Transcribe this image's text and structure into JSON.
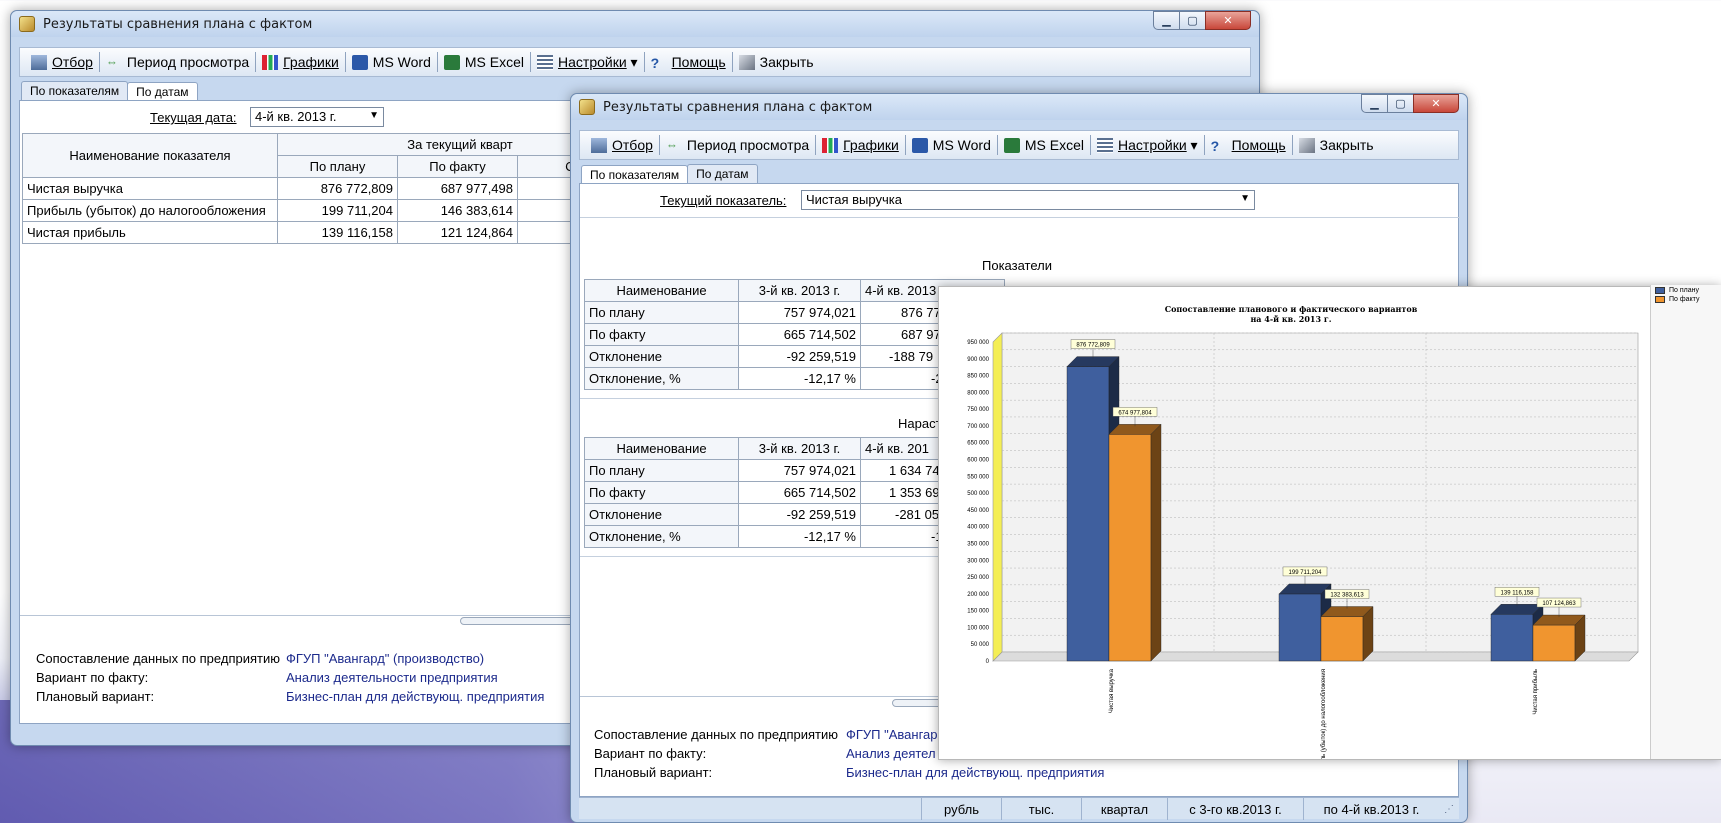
{
  "window_back": {
    "title": "Результаты сравнения плана с фактом",
    "toolbar": [
      "Отбор",
      "Период просмотра",
      "Графики",
      "MS Word",
      "MS Excel",
      "Настройки",
      "Помощь",
      "Закрыть"
    ],
    "tabs": [
      "По показателям",
      "По датам"
    ],
    "current_date_label": "Текущая дата:",
    "current_date_value": "4-й кв. 2013 г.",
    "table": {
      "name_header": "Наименование показателя",
      "group_header": "За текущий кварт",
      "columns": [
        "По плану",
        "По факту",
        "Откл"
      ],
      "rows": [
        {
          "name": "Чистая выручка",
          "plan": "876 772,809",
          "fact": "687 977,498",
          "dev": "-1"
        },
        {
          "name": "Прибыль (убыток) до налогообложения",
          "plan": "199 711,204",
          "fact": "146 383,614",
          "dev": "-"
        },
        {
          "name": "Чистая прибыль",
          "plan": "139 116,158",
          "fact": "121 124,864",
          "dev": "-"
        }
      ]
    },
    "footer": {
      "compare_label": "Сопоставление данных по предприятию",
      "compare_value": "ФГУП \"Авангард\" (производство)",
      "fact_label": "Вариант по факту:",
      "fact_value": "Анализ деятельности предприятия",
      "plan_label": "Плановый вариант:",
      "plan_value": "Бизнес-план для действующ. предприятия"
    }
  },
  "window_front": {
    "title": "Результаты сравнения плана с фактом",
    "toolbar": [
      "Отбор",
      "Период просмотра",
      "Графики",
      "MS Word",
      "MS Excel",
      "Настройки",
      "Помощь",
      "Закрыть"
    ],
    "tabs": [
      "По показателям",
      "По датам"
    ],
    "current_indicator_label": "Текущий показатель:",
    "current_indicator_value": "Чистая выручка",
    "section1_title": "Показатели",
    "section2_title": "Нараст",
    "table_headers": [
      "Наименование",
      "3-й кв. 2013 г.",
      "4-й кв. 2013"
    ],
    "table1": [
      {
        "name": "По плану",
        "q3": "757 974,021",
        "q4": "876 77"
      },
      {
        "name": "По факту",
        "q3": "665 714,502",
        "q4": "687 97"
      },
      {
        "name": "Отклонение",
        "q3": "-92 259,519",
        "q4": "-188 79"
      },
      {
        "name": "Отклонение, %",
        "q3": "-12,17 %",
        "q4": "-21,"
      }
    ],
    "table2_headers": [
      "Наименование",
      "3-й кв. 2013 г.",
      "4-й кв. 201"
    ],
    "table2": [
      {
        "name": "По плану",
        "q3": "757 974,021",
        "q4": "1 634 74"
      },
      {
        "name": "По факту",
        "q3": "665 714,502",
        "q4": "1 353 69"
      },
      {
        "name": "Отклонение",
        "q3": "-92 259,519",
        "q4": "-281 05"
      },
      {
        "name": "Отклонение, %",
        "q3": "-12,17 %",
        "q4": "-17,"
      }
    ],
    "footer": {
      "compare_label": "Сопоставление данных по предприятию",
      "compare_value": "ФГУП \"Авангар",
      "fact_label": "Вариант по факту:",
      "fact_value": "Анализ деятел",
      "plan_label": "Плановый вариант:",
      "plan_value": "Бизнес-план для действующ. предприятия"
    },
    "status": [
      "рубль",
      "тыс.",
      "квартал",
      "с 3-го кв.2013 г.",
      "по 4-й кв.2013 г."
    ]
  },
  "colors": {
    "plan": "#3f5f9e",
    "fact": "#f0952f",
    "wall": "#f2f2f2"
  },
  "chart_data": {
    "type": "bar",
    "title": "Сопоставление планового и фактического вариантов",
    "subtitle": "на 4-й кв. 2013 г.",
    "categories": [
      "Чистая выручка",
      "Прибыль (убыток) до налогообложения",
      "Чистая прибыль"
    ],
    "series": [
      {
        "name": "По плану",
        "values": [
          876772.809,
          199711.204,
          139116.158
        ]
      },
      {
        "name": "По факту",
        "values": [
          674977.804,
          132383.613,
          107124.863
        ]
      }
    ],
    "data_labels": [
      [
        "876 772,809",
        "199 711,204",
        "139 116,158"
      ],
      [
        "674 977,804",
        "132 383,613",
        "107 124,863"
      ]
    ],
    "ylim": [
      0,
      950000
    ],
    "yticks": [
      "0",
      "50 000",
      "100 000",
      "150 000",
      "200 000",
      "250 000",
      "300 000",
      "350 000",
      "400 000",
      "450 000",
      "500 000",
      "550 000",
      "600 000",
      "650 000",
      "700 000",
      "750 000",
      "800 000",
      "850 000",
      "900 000",
      "950 000"
    ],
    "grid": true,
    "legend": "top-right"
  }
}
